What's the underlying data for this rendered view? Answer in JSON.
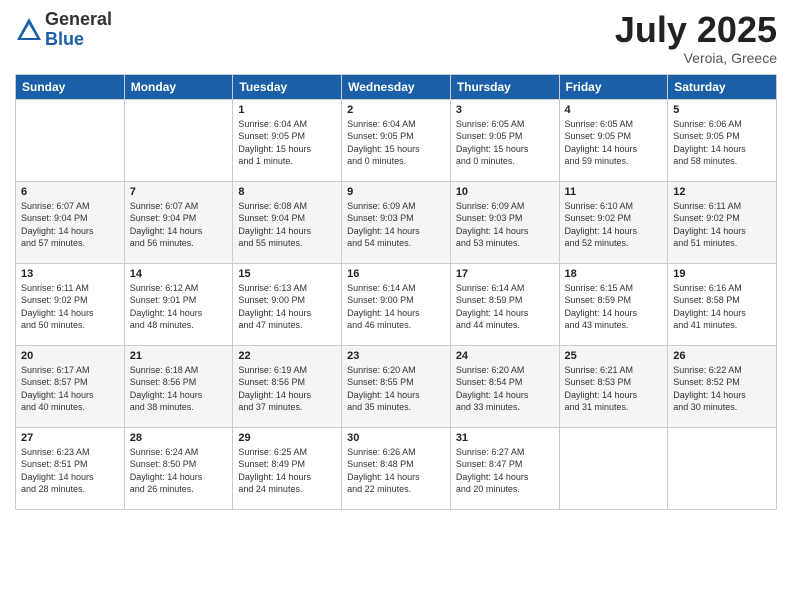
{
  "logo": {
    "general": "General",
    "blue": "Blue"
  },
  "header": {
    "month": "July 2025",
    "location": "Veroia, Greece"
  },
  "days_of_week": [
    "Sunday",
    "Monday",
    "Tuesday",
    "Wednesday",
    "Thursday",
    "Friday",
    "Saturday"
  ],
  "weeks": [
    [
      {
        "day": "",
        "info": ""
      },
      {
        "day": "",
        "info": ""
      },
      {
        "day": "1",
        "info": "Sunrise: 6:04 AM\nSunset: 9:05 PM\nDaylight: 15 hours\nand 1 minute."
      },
      {
        "day": "2",
        "info": "Sunrise: 6:04 AM\nSunset: 9:05 PM\nDaylight: 15 hours\nand 0 minutes."
      },
      {
        "day": "3",
        "info": "Sunrise: 6:05 AM\nSunset: 9:05 PM\nDaylight: 15 hours\nand 0 minutes."
      },
      {
        "day": "4",
        "info": "Sunrise: 6:05 AM\nSunset: 9:05 PM\nDaylight: 14 hours\nand 59 minutes."
      },
      {
        "day": "5",
        "info": "Sunrise: 6:06 AM\nSunset: 9:05 PM\nDaylight: 14 hours\nand 58 minutes."
      }
    ],
    [
      {
        "day": "6",
        "info": "Sunrise: 6:07 AM\nSunset: 9:04 PM\nDaylight: 14 hours\nand 57 minutes."
      },
      {
        "day": "7",
        "info": "Sunrise: 6:07 AM\nSunset: 9:04 PM\nDaylight: 14 hours\nand 56 minutes."
      },
      {
        "day": "8",
        "info": "Sunrise: 6:08 AM\nSunset: 9:04 PM\nDaylight: 14 hours\nand 55 minutes."
      },
      {
        "day": "9",
        "info": "Sunrise: 6:09 AM\nSunset: 9:03 PM\nDaylight: 14 hours\nand 54 minutes."
      },
      {
        "day": "10",
        "info": "Sunrise: 6:09 AM\nSunset: 9:03 PM\nDaylight: 14 hours\nand 53 minutes."
      },
      {
        "day": "11",
        "info": "Sunrise: 6:10 AM\nSunset: 9:02 PM\nDaylight: 14 hours\nand 52 minutes."
      },
      {
        "day": "12",
        "info": "Sunrise: 6:11 AM\nSunset: 9:02 PM\nDaylight: 14 hours\nand 51 minutes."
      }
    ],
    [
      {
        "day": "13",
        "info": "Sunrise: 6:11 AM\nSunset: 9:02 PM\nDaylight: 14 hours\nand 50 minutes."
      },
      {
        "day": "14",
        "info": "Sunrise: 6:12 AM\nSunset: 9:01 PM\nDaylight: 14 hours\nand 48 minutes."
      },
      {
        "day": "15",
        "info": "Sunrise: 6:13 AM\nSunset: 9:00 PM\nDaylight: 14 hours\nand 47 minutes."
      },
      {
        "day": "16",
        "info": "Sunrise: 6:14 AM\nSunset: 9:00 PM\nDaylight: 14 hours\nand 46 minutes."
      },
      {
        "day": "17",
        "info": "Sunrise: 6:14 AM\nSunset: 8:59 PM\nDaylight: 14 hours\nand 44 minutes."
      },
      {
        "day": "18",
        "info": "Sunrise: 6:15 AM\nSunset: 8:59 PM\nDaylight: 14 hours\nand 43 minutes."
      },
      {
        "day": "19",
        "info": "Sunrise: 6:16 AM\nSunset: 8:58 PM\nDaylight: 14 hours\nand 41 minutes."
      }
    ],
    [
      {
        "day": "20",
        "info": "Sunrise: 6:17 AM\nSunset: 8:57 PM\nDaylight: 14 hours\nand 40 minutes."
      },
      {
        "day": "21",
        "info": "Sunrise: 6:18 AM\nSunset: 8:56 PM\nDaylight: 14 hours\nand 38 minutes."
      },
      {
        "day": "22",
        "info": "Sunrise: 6:19 AM\nSunset: 8:56 PM\nDaylight: 14 hours\nand 37 minutes."
      },
      {
        "day": "23",
        "info": "Sunrise: 6:20 AM\nSunset: 8:55 PM\nDaylight: 14 hours\nand 35 minutes."
      },
      {
        "day": "24",
        "info": "Sunrise: 6:20 AM\nSunset: 8:54 PM\nDaylight: 14 hours\nand 33 minutes."
      },
      {
        "day": "25",
        "info": "Sunrise: 6:21 AM\nSunset: 8:53 PM\nDaylight: 14 hours\nand 31 minutes."
      },
      {
        "day": "26",
        "info": "Sunrise: 6:22 AM\nSunset: 8:52 PM\nDaylight: 14 hours\nand 30 minutes."
      }
    ],
    [
      {
        "day": "27",
        "info": "Sunrise: 6:23 AM\nSunset: 8:51 PM\nDaylight: 14 hours\nand 28 minutes."
      },
      {
        "day": "28",
        "info": "Sunrise: 6:24 AM\nSunset: 8:50 PM\nDaylight: 14 hours\nand 26 minutes."
      },
      {
        "day": "29",
        "info": "Sunrise: 6:25 AM\nSunset: 8:49 PM\nDaylight: 14 hours\nand 24 minutes."
      },
      {
        "day": "30",
        "info": "Sunrise: 6:26 AM\nSunset: 8:48 PM\nDaylight: 14 hours\nand 22 minutes."
      },
      {
        "day": "31",
        "info": "Sunrise: 6:27 AM\nSunset: 8:47 PM\nDaylight: 14 hours\nand 20 minutes."
      },
      {
        "day": "",
        "info": ""
      },
      {
        "day": "",
        "info": ""
      }
    ]
  ]
}
